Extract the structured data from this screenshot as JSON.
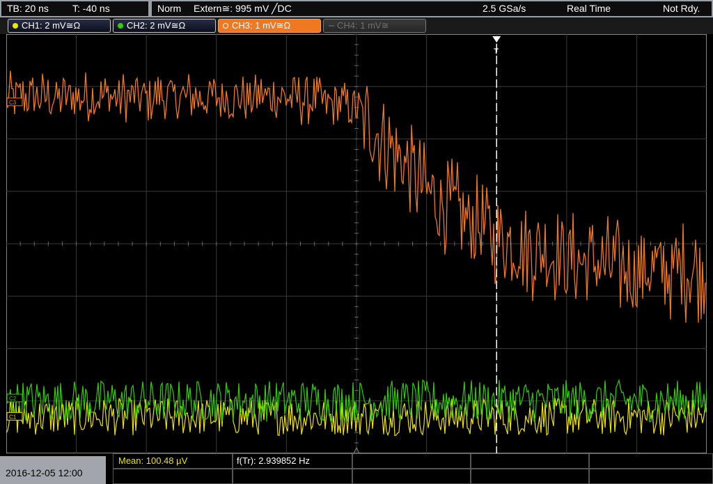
{
  "status_bar": {
    "timebase": "TB: 20 ns",
    "trigger_offset": "T: -40 ns",
    "trigger_mode": "Norm",
    "trigger_source": "Extern≅: 995 mV ╱DC",
    "sample_rate": "2.5 GSa/s",
    "acquisition_mode": "Real Time",
    "ready_state": "Not Rdy."
  },
  "channels": [
    {
      "label": "CH1: 2 mV≅Ω",
      "color": "#f0e400",
      "state": "on"
    },
    {
      "label": "CH2: 2 mV≅Ω",
      "color": "#30d000",
      "state": "on"
    },
    {
      "label": "CH3: 1 mV≅Ω",
      "color": "#f07820",
      "state": "selected"
    },
    {
      "label": "CH4: 1 mV≅",
      "color": "#606060",
      "state": "off"
    }
  ],
  "trace_markers": {
    "ch3": "C3",
    "ch2": "C2",
    "ch1": "C1",
    "trigger": "T"
  },
  "measurements": {
    "mean": "Mean: 100.48 µV",
    "frequency": "f(Tr): 2.939852 Hz"
  },
  "datetime": "2016-12-05 12:00",
  "colors": {
    "ch1": "#f0e400",
    "ch2": "#30d000",
    "ch3": "#f07820",
    "grid": "#3a3a3a",
    "trigger_line": "#ffffff"
  },
  "chart_data": {
    "type": "line",
    "description_note": "",
    "divisions": {
      "x": 10,
      "y": 8
    },
    "x_range_divisions": [
      0,
      10
    ],
    "y_range_divisions": [
      -4,
      4
    ],
    "trigger_time_division": 7,
    "series": [
      {
        "name": "CH3",
        "color": "#f07820",
        "envelope_mid_divisions": [
          2.8,
          2.8,
          2.8,
          2.8,
          2.8,
          2.6,
          1.0,
          0.1,
          -0.3,
          -0.5,
          -0.5
        ],
        "peak_to_peak_divisions": 1.2,
        "step_time_division": 5.1
      },
      {
        "name": "CH2",
        "color": "#30d000",
        "level_divisions": -3.0,
        "peak_to_peak_divisions": 0.5
      },
      {
        "name": "CH1",
        "color": "#f0e400",
        "level_divisions": -3.3,
        "peak_to_peak_divisions": 0.45
      }
    ]
  }
}
